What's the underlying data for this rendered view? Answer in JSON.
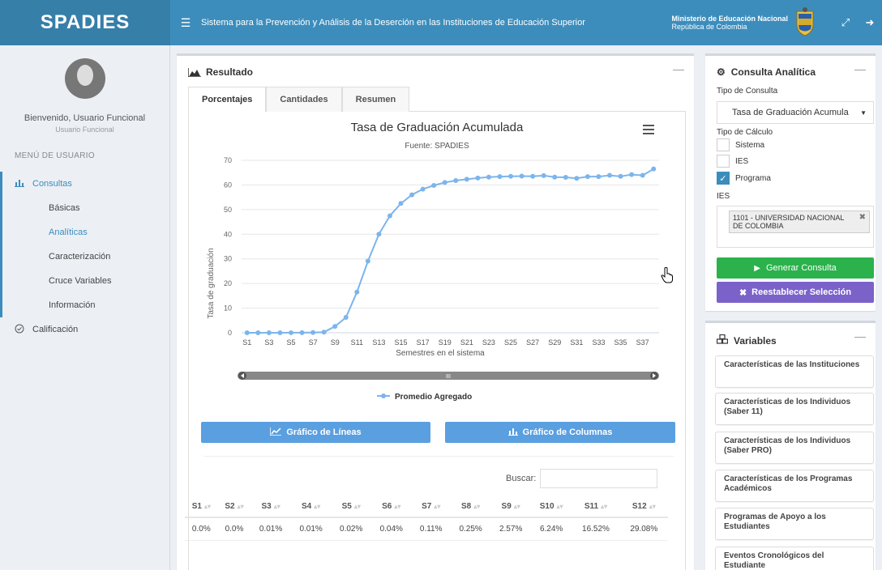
{
  "header": {
    "brand": "SPADIES",
    "system_title": "Sistema para la Prevención y Análisis de la Deserción en las Instituciones de Educación Superior",
    "ministry": "Ministerio de Educación Nacional",
    "country": "República de Colombia"
  },
  "sidebar": {
    "welcome": "Bienvenido, Usuario Funcional",
    "role": "Usuario Funcional",
    "menu_header": "MENÚ DE USUARIO",
    "items": [
      {
        "label": "Consultas"
      },
      {
        "label": "Básicas"
      },
      {
        "label": "Analíticas"
      },
      {
        "label": "Caracterización"
      },
      {
        "label": "Cruce Variables"
      },
      {
        "label": "Información"
      },
      {
        "label": "Calificación"
      }
    ]
  },
  "result": {
    "title": "Resultado",
    "tabs": [
      "Porcentajes",
      "Cantidades",
      "Resumen"
    ],
    "btn_lines": "Gráfico de Líneas",
    "btn_columns": "Gráfico de Columnas",
    "search_label": "Buscar:",
    "table": {
      "headers": [
        "S1",
        "S2",
        "S3",
        "S4",
        "S5",
        "S6",
        "S7",
        "S8",
        "S9",
        "S10",
        "S11",
        "S12"
      ],
      "row": [
        "0.0%",
        "0.0%",
        "0.01%",
        "0.01%",
        "0.02%",
        "0.04%",
        "0.11%",
        "0.25%",
        "2.57%",
        "6.24%",
        "16.52%",
        "29.08%"
      ]
    }
  },
  "chart_data": {
    "type": "line",
    "title": "Tasa de Graduación Acumulada",
    "subtitle": "Fuente: SPADIES",
    "xlabel": "Semestres en el sistema",
    "ylabel": "Tasa de graduación",
    "ylim": [
      0,
      70
    ],
    "yticks": [
      0,
      10,
      20,
      30,
      40,
      50,
      60,
      70
    ],
    "xtick_labels": [
      "S1",
      "S3",
      "S5",
      "S7",
      "S9",
      "S11",
      "S13",
      "S15",
      "S17",
      "S19",
      "S21",
      "S23",
      "S25",
      "S27",
      "S29",
      "S31",
      "S33",
      "S35",
      "S37"
    ],
    "grid": true,
    "legend_position": "bottom",
    "color": "#7cb5ec",
    "series": [
      {
        "name": "Promedio Agregado",
        "x": [
          "S1",
          "S2",
          "S3",
          "S4",
          "S5",
          "S6",
          "S7",
          "S8",
          "S9",
          "S10",
          "S11",
          "S12",
          "S13",
          "S14",
          "S15",
          "S16",
          "S17",
          "S18",
          "S19",
          "S20",
          "S21",
          "S22",
          "S23",
          "S24",
          "S25",
          "S26",
          "S27",
          "S28",
          "S29",
          "S30",
          "S31",
          "S32",
          "S33",
          "S34",
          "S35",
          "S36",
          "S37",
          "S38"
        ],
        "values": [
          0.0,
          0.0,
          0.01,
          0.01,
          0.02,
          0.04,
          0.11,
          0.25,
          2.57,
          6.24,
          16.52,
          29.08,
          40.0,
          47.5,
          52.5,
          56.0,
          58.3,
          59.8,
          61.0,
          61.8,
          62.3,
          62.8,
          63.2,
          63.4,
          63.5,
          63.6,
          63.5,
          63.8,
          63.2,
          63.1,
          62.7,
          63.4,
          63.4,
          63.9,
          63.5,
          64.2,
          63.9,
          66.5
        ]
      }
    ]
  },
  "consulta": {
    "title": "Consulta Analítica",
    "tipo_consulta_label": "Tipo de Consulta",
    "tipo_consulta_value": "Tasa de Graduación Acumula",
    "tipo_calculo_label": "Tipo de Cálculo",
    "options": [
      {
        "label": "Sistema",
        "checked": false
      },
      {
        "label": "IES",
        "checked": false
      },
      {
        "label": "Programa",
        "checked": true
      }
    ],
    "ies_label": "IES",
    "ies_value": "1101 - UNIVERSIDAD NACIONAL DE COLOMBIA",
    "btn_generar": "Generar Consulta",
    "btn_reset": "Reestablecer Selección"
  },
  "variables": {
    "title": "Variables",
    "items": [
      "Características de las Instituciones",
      "Características de los Individuos (Saber 11)",
      "Características de los Individuos (Saber PRO)",
      "Características de los Programas Académicos",
      "Programas de Apoyo a los Estudiantes",
      "Eventos Cronológicos del Estudiante"
    ]
  }
}
